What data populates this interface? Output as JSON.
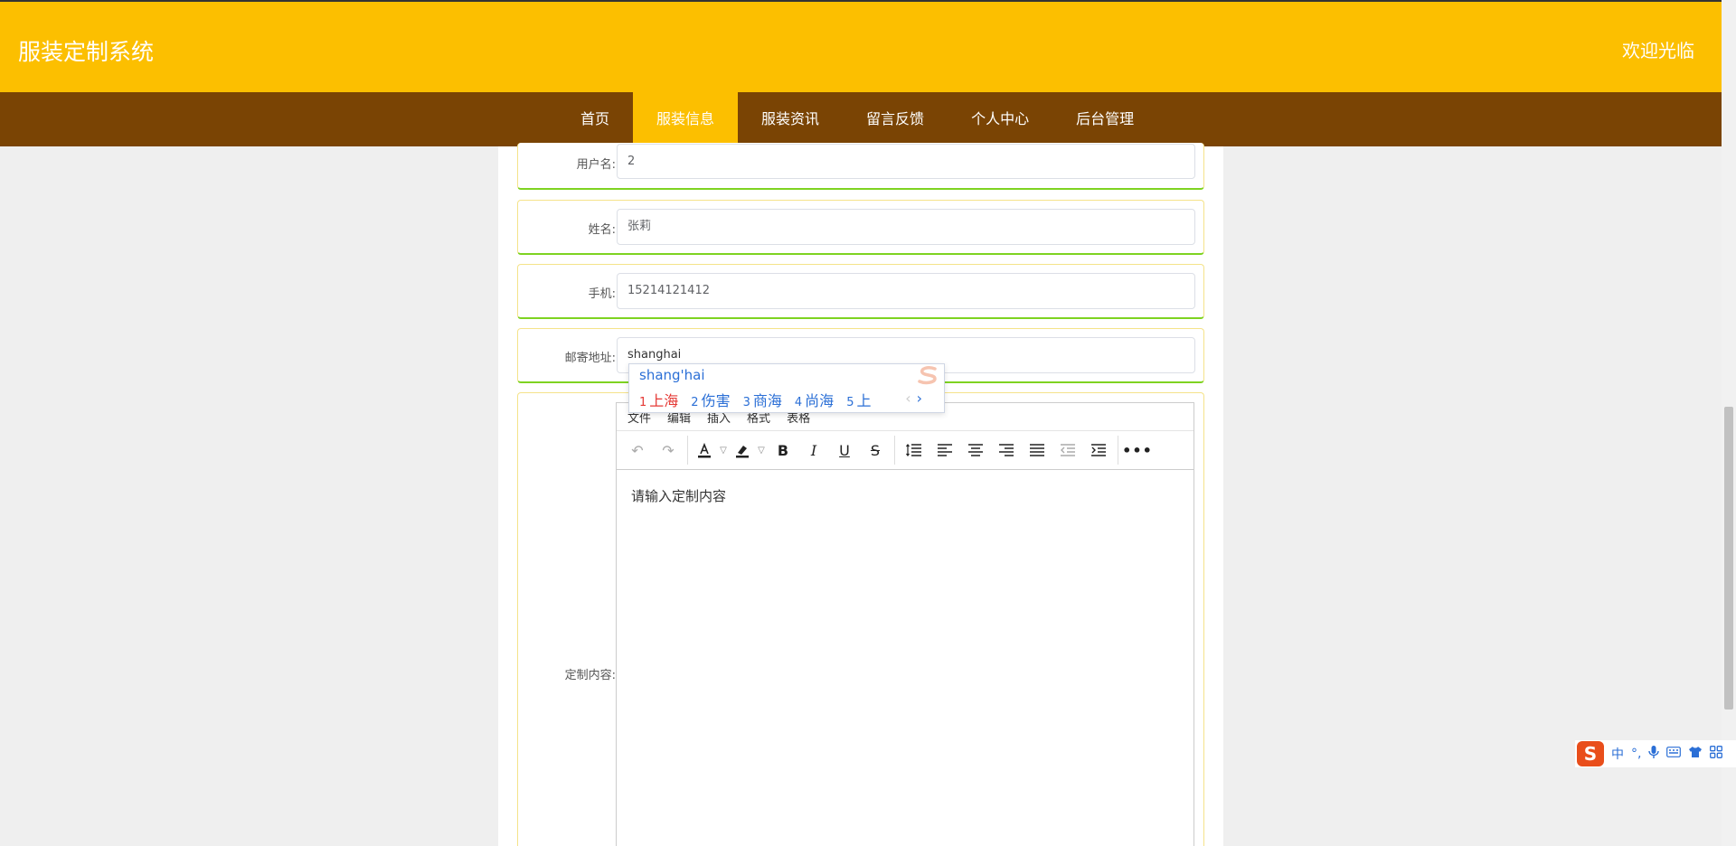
{
  "header": {
    "site_title": "服装定制系统",
    "welcome": "欢迎光临"
  },
  "nav": {
    "items": [
      {
        "label": "首页"
      },
      {
        "label": "服装信息"
      },
      {
        "label": "服装资讯"
      },
      {
        "label": "留言反馈"
      },
      {
        "label": "个人中心"
      },
      {
        "label": "后台管理"
      }
    ],
    "active_index": 1
  },
  "form": {
    "username": {
      "label": "用户名:",
      "value": "2"
    },
    "name": {
      "label": "姓名:",
      "value": "张莉"
    },
    "phone": {
      "label": "手机:",
      "value": "15214121412"
    },
    "address": {
      "label": "邮寄地址:",
      "value": "shanghai"
    },
    "content": {
      "label": "定制内容:"
    }
  },
  "ime_popup": {
    "pinyin": "shang'hai",
    "candidates": [
      {
        "num": "1",
        "text": "上海"
      },
      {
        "num": "2",
        "text": "伤害"
      },
      {
        "num": "3",
        "text": "商海"
      },
      {
        "num": "4",
        "text": "尚海"
      },
      {
        "num": "5",
        "text": "上"
      }
    ],
    "prev_arrow": "‹",
    "next_arrow": "›"
  },
  "editor": {
    "menu": [
      "文件",
      "编辑",
      "插入",
      "格式",
      "表格"
    ],
    "placeholder": "请输入定制内容"
  },
  "ime_toolbar": {
    "logo": "S",
    "mode": "中",
    "punct": "°,",
    "icons": [
      "microphone-icon",
      "keyboard-icon",
      "skin-icon",
      "grid-icon"
    ]
  },
  "colors": {
    "header": "#fcbf00",
    "nav": "#7a4404",
    "nav_active": "#fcbf00",
    "row_border": "#7ed321"
  }
}
